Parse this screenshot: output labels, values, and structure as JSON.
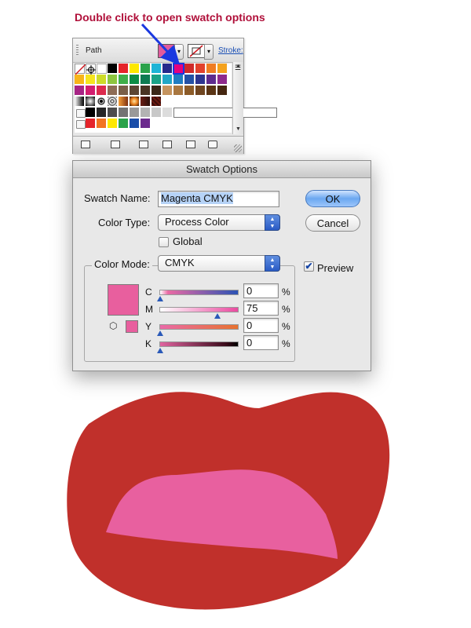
{
  "callout": {
    "text": "Double click to open swatch options"
  },
  "swatches_panel": {
    "object_label": "Path",
    "stroke_label": "Stroke:",
    "colors": {
      "fill": "#e05a9d",
      "selection_outline": "#1a38e0",
      "arrow": "#1a38e0",
      "callout_text": "#b0103a"
    }
  },
  "dialog": {
    "title": "Swatch Options",
    "swatch_name_label": "Swatch Name:",
    "swatch_name_value": "Magenta CMYK",
    "color_type_label": "Color Type:",
    "color_type_value": "Process Color",
    "global_label": "Global",
    "global_checked": false,
    "color_mode_label": "Color Mode:",
    "color_mode_value": "CMYK",
    "ok_label": "OK",
    "cancel_label": "Cancel",
    "preview_label": "Preview",
    "preview_checked": true,
    "preview_color": "#e85f9e",
    "channels": [
      {
        "name": "C",
        "value": "0",
        "unit": "%"
      },
      {
        "name": "M",
        "value": "75",
        "unit": "%"
      },
      {
        "name": "Y",
        "value": "0",
        "unit": "%"
      },
      {
        "name": "K",
        "value": "0",
        "unit": "%"
      }
    ]
  },
  "lips": {
    "outer_color": "#c0302b",
    "inner_color": "#e8609f"
  }
}
